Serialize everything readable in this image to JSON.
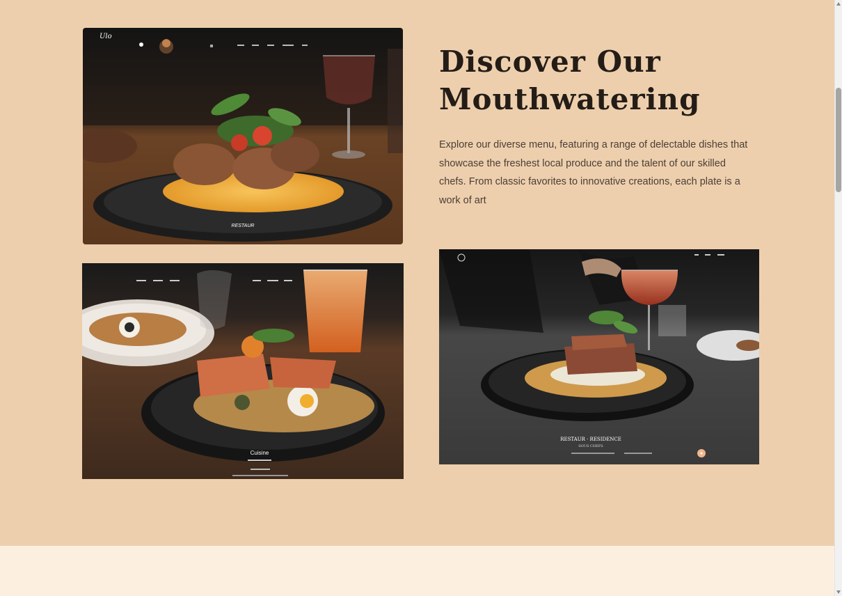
{
  "colors": {
    "section_bg": "#eecfad",
    "next_section_bg": "#fcefe0",
    "heading": "#241d17",
    "body_text": "#4a3f36"
  },
  "heading": {
    "line1": "Discover Our",
    "line2": "Mouthwatering"
  },
  "description": "Explore our diverse menu, featuring a range of delectable dishes that showcase the freshest local produce and the talent of our skilled chefs. From classic favorites to innovative creations, each plate is a work of art",
  "images": [
    {
      "id": "photo-1",
      "alt": "Plated seared scallops with herbs and tomato on golden sauce, glass of wine"
    },
    {
      "id": "photo-2",
      "alt": "Grilled salmon over chickpeas, olives and egg on a dark plate, orange juice"
    },
    {
      "id": "photo-3",
      "alt": "Sliced steak on purée with roasted vegetables, glass of red wine"
    }
  ]
}
